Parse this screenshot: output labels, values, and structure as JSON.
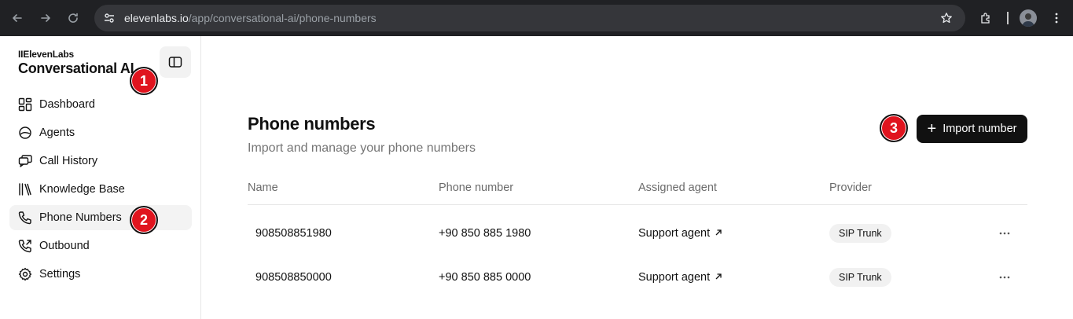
{
  "browser": {
    "url_host": "elevenlabs.io",
    "url_path": "/app/conversational-ai/phone-numbers"
  },
  "sidebar": {
    "logo": "IIElevenLabs",
    "app_title": "Conversational AI",
    "items": [
      {
        "label": "Dashboard",
        "icon": "dashboard-icon"
      },
      {
        "label": "Agents",
        "icon": "agents-icon"
      },
      {
        "label": "Call History",
        "icon": "call-history-icon"
      },
      {
        "label": "Knowledge Base",
        "icon": "knowledge-base-icon"
      },
      {
        "label": "Phone Numbers",
        "icon": "phone-icon",
        "active": true
      },
      {
        "label": "Outbound",
        "icon": "outbound-icon"
      },
      {
        "label": "Settings",
        "icon": "settings-icon"
      }
    ]
  },
  "badges": [
    "1",
    "2",
    "3"
  ],
  "main": {
    "title": "Phone numbers",
    "subtitle": "Import and manage your phone numbers",
    "import_label": "Import number",
    "columns": [
      "Name",
      "Phone number",
      "Assigned agent",
      "Provider"
    ],
    "rows": [
      {
        "name": "908508851980",
        "phone": "+90 850 885 1980",
        "agent": "Support agent",
        "provider": "SIP Trunk"
      },
      {
        "name": "908508850000",
        "phone": "+90 850 885 0000",
        "agent": "Support agent",
        "provider": "SIP Trunk"
      }
    ]
  },
  "colors": {
    "badge": "#e0141e",
    "button": "#111111",
    "chrome": "#202124"
  }
}
